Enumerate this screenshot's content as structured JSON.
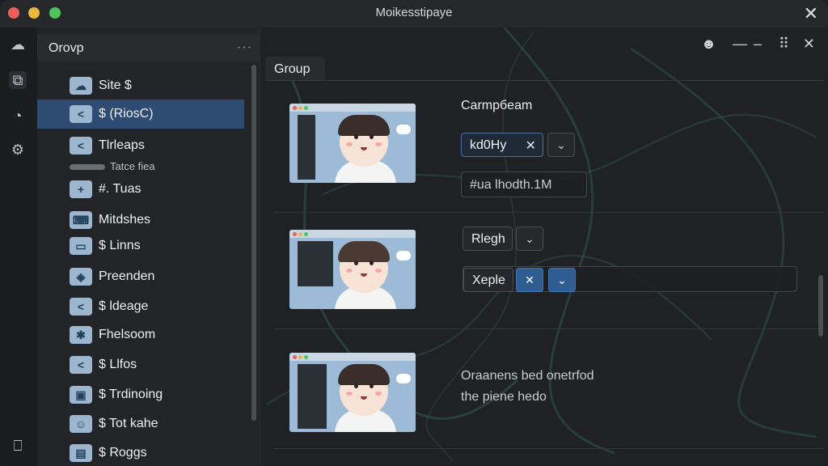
{
  "window": {
    "title": "Moikesstipaye"
  },
  "sidebar": {
    "header": "Orovp",
    "items": [
      {
        "label": "Site $",
        "icon": "cloud-icon",
        "selected": false
      },
      {
        "label": "$ (RiosC)",
        "icon": "share-icon",
        "selected": true
      },
      {
        "label": "Tlrleaps",
        "icon": "share-icon",
        "selected": false
      },
      {
        "label": "#. Tuas",
        "icon": "plus-icon",
        "selected": false
      },
      {
        "label": "Mitdshes",
        "icon": "keyboard-icon",
        "selected": false
      },
      {
        "label": "$ Linns",
        "icon": "truck-icon",
        "selected": false
      },
      {
        "label": "Preenden",
        "icon": "shield-icon",
        "selected": false
      },
      {
        "label": "$ ldeage",
        "icon": "share-icon",
        "selected": false
      },
      {
        "label": "Fhelsoom",
        "icon": "gear-icon",
        "selected": false
      },
      {
        "label": "$ Llfos",
        "icon": "share-icon",
        "selected": false
      },
      {
        "label": "$ Trdinoing",
        "icon": "monitor-icon",
        "selected": false
      },
      {
        "label": "$ Tot kahe",
        "icon": "person-icon",
        "selected": false
      },
      {
        "label": "$ Roggs",
        "icon": "window-icon",
        "selected": false
      }
    ],
    "sub_label": "Tatce fiea"
  },
  "main": {
    "tab": "Group",
    "rows": [
      {
        "title": "Carmpбeam",
        "chip": "kd0Hy",
        "input_text": "#ua lhodth.1M"
      },
      {
        "button": "Rlegh",
        "chip": "Xeple"
      },
      {
        "description_line1": "Oraanens bed onetrfod",
        "description_line2": "the piene hedo"
      }
    ]
  },
  "colors": {
    "accent": "#2d4b73",
    "chip_border": "#4f6f9a",
    "blue_button": "#2f5d92"
  }
}
